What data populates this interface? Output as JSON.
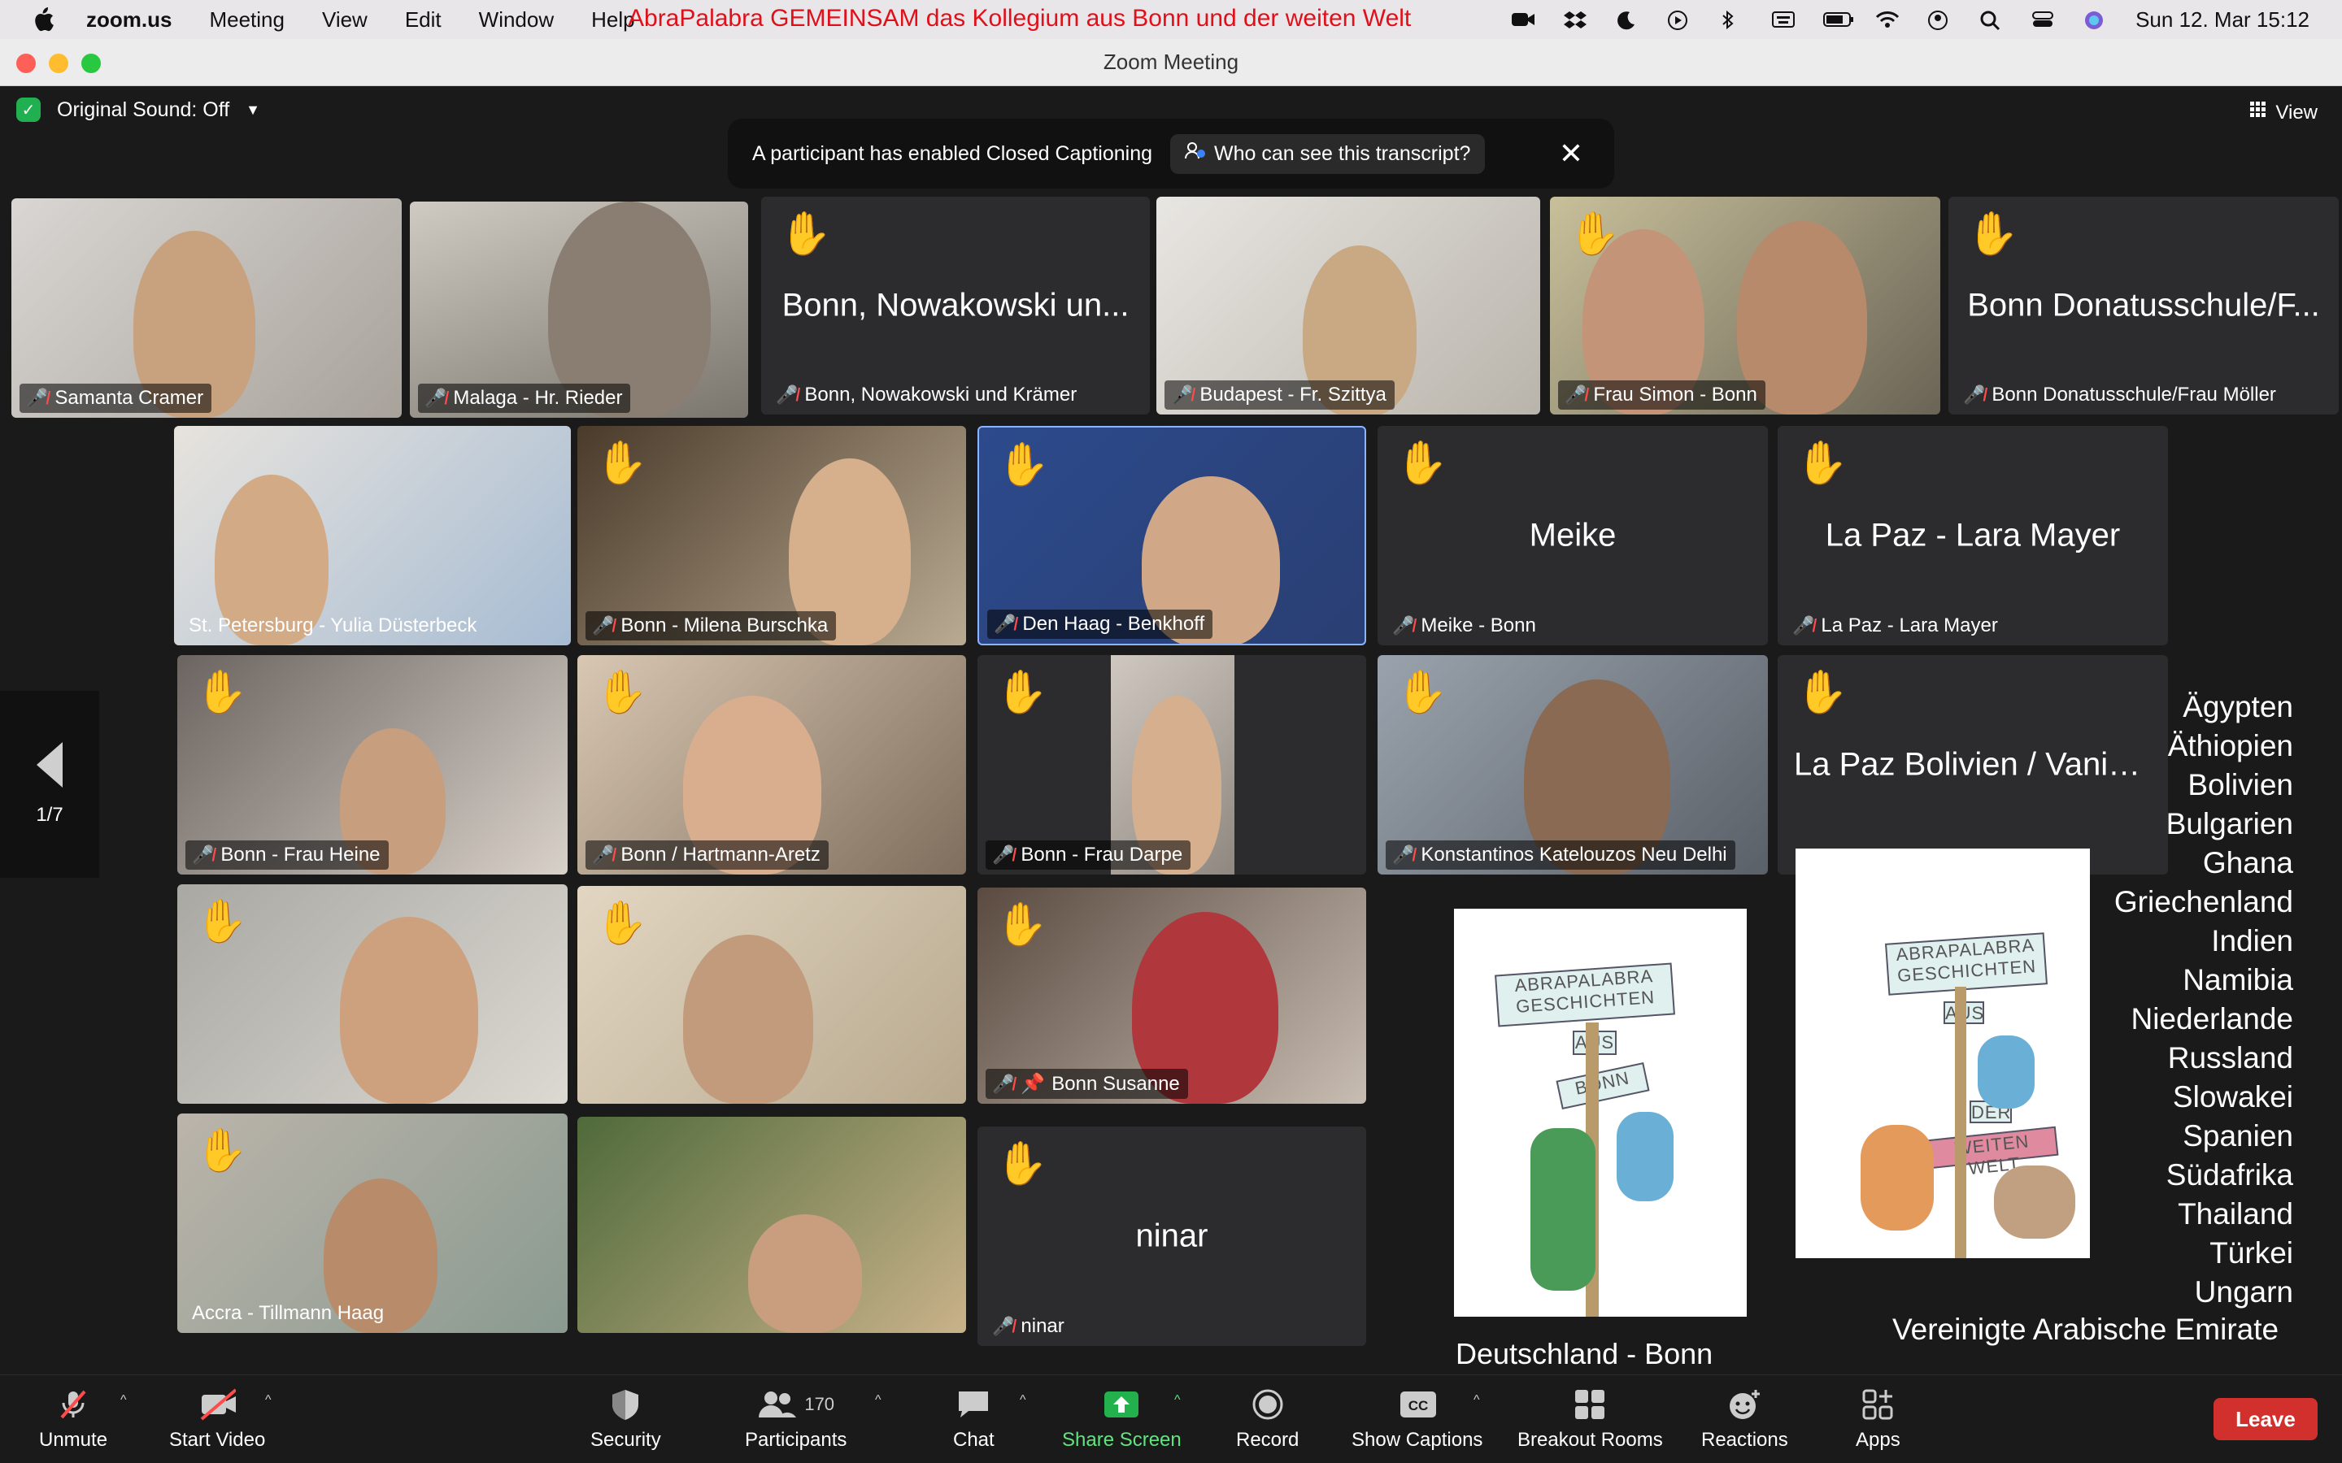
{
  "menubar": {
    "app_name": "zoom.us",
    "items": [
      "Meeting",
      "View",
      "Edit",
      "Window",
      "Help"
    ],
    "banner_text": "AbraPalabra GEMEINSAM das Kollegium aus Bonn und der weiten Welt",
    "datetime": "Sun 12. Mar  15:12"
  },
  "window": {
    "title": "Zoom Meeting"
  },
  "topbar": {
    "original_sound": "Original Sound: Off",
    "view": "View"
  },
  "cc_banner": {
    "message": "A participant has enabled Closed Captioning",
    "who_can_see": "Who can see this transcript?"
  },
  "page_nav": {
    "page": "1/7"
  },
  "tiles": {
    "t1": {
      "name": "Samanta Cramer"
    },
    "t2": {
      "name": "Malaga - Hr. Rieder"
    },
    "t3": {
      "big": "Bonn, Nowakowski un...",
      "name": "Bonn, Nowakowski und Krämer"
    },
    "t4": {
      "name": "Budapest - Fr. Szittya"
    },
    "t5": {
      "name": "Frau Simon - Bonn"
    },
    "t6": {
      "big": "Bonn Donatusschule/F...",
      "name": "Bonn Donatusschule/Frau Möller"
    },
    "t7": {
      "name": "St. Petersburg - Yulia Düsterbeck"
    },
    "t8": {
      "name": "Bonn - Milena Burschka"
    },
    "t9": {
      "name": "Den Haag - Benkhoff"
    },
    "t10": {
      "big": "Meike",
      "name": "Meike  - Bonn"
    },
    "t11": {
      "big": "La Paz - Lara Mayer",
      "name": "La Paz - Lara Mayer"
    },
    "t12": {
      "name": "Bonn - Frau Heine"
    },
    "t13": {
      "name": "Bonn / Hartmann-Aretz"
    },
    "t14": {
      "name": "Bonn - Frau Darpe"
    },
    "t15": {
      "name": "Konstantinos Katelouzos Neu Delhi"
    },
    "t16": {
      "big": "La Paz Bolivien / Vania..."
    },
    "t19": {
      "name": "Bonn Susanne"
    },
    "t20": {
      "name": "Accra - Tillmann Haag"
    },
    "t22": {
      "big": "ninar",
      "name": "ninar"
    }
  },
  "shared": {
    "book1_title": [
      "ABRAPALABRA",
      "GESCHICHTEN",
      "AUS",
      "BONN"
    ],
    "book2_title": [
      "ABRAPALABRA",
      "GESCHICHTEN",
      "AUS",
      "DER",
      "WEITEN WELT"
    ],
    "caption": "Deutschland - Bonn",
    "countries": [
      "Ägypten",
      "Äthiopien",
      "Bolivien",
      "Bulgarien",
      "Ghana",
      "Griechenland",
      "Indien",
      "Namibia",
      "Niederlande",
      "Russland",
      "Slowakei",
      "Spanien",
      "Südafrika",
      "Thailand",
      "Türkei",
      "Ungarn"
    ],
    "countries_last": "Vereinigte Arabische Emirate"
  },
  "toolbar": {
    "unmute": "Unmute",
    "start_video": "Start Video",
    "security": "Security",
    "participants": "Participants",
    "participants_count": "170",
    "chat": "Chat",
    "share_screen": "Share Screen",
    "record": "Record",
    "show_captions": "Show Captions",
    "breakout_rooms": "Breakout Rooms",
    "reactions": "Reactions",
    "apps": "Apps",
    "leave": "Leave"
  }
}
